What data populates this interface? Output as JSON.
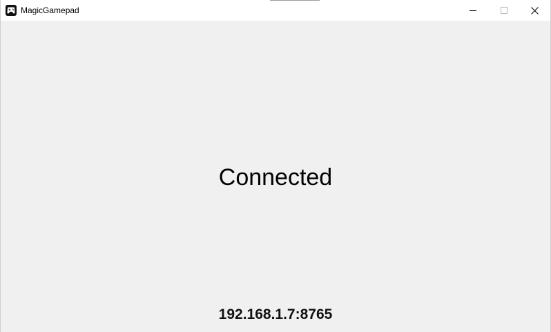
{
  "window": {
    "title": "MagicGamepad",
    "app_icon": "gamepad-app-icon",
    "controls": {
      "minimize_icon": "minimize-icon",
      "maximize_icon": "maximize-icon",
      "close_icon": "close-icon"
    }
  },
  "main": {
    "status": "Connected",
    "address": "192.168.1.7:8765"
  },
  "colors": {
    "titlebar_background": "#ffffff",
    "client_background": "#f0f0f0",
    "text": "#000000"
  }
}
